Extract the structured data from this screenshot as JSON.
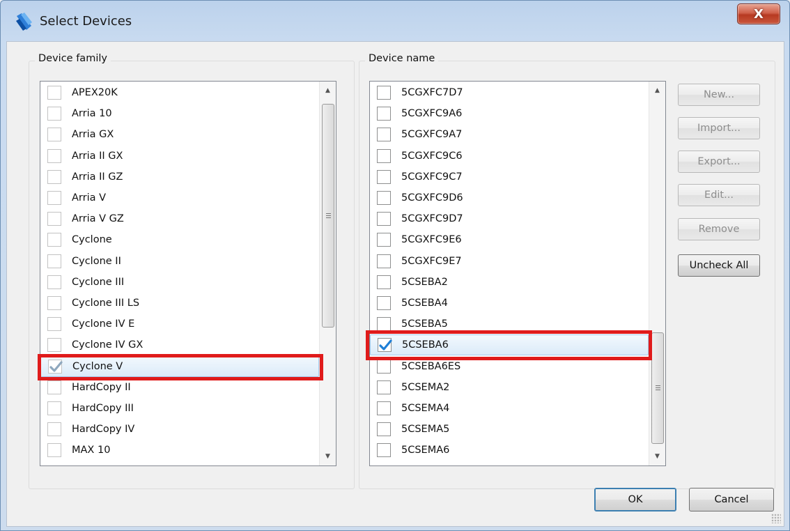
{
  "window": {
    "title": "Select Devices",
    "close_label": "X"
  },
  "device_family": {
    "label": "Device family",
    "items": [
      {
        "label": "APEX20K",
        "checked": false
      },
      {
        "label": "Arria 10",
        "checked": false
      },
      {
        "label": "Arria GX",
        "checked": false
      },
      {
        "label": "Arria II GX",
        "checked": false
      },
      {
        "label": "Arria II GZ",
        "checked": false
      },
      {
        "label": "Arria V",
        "checked": false
      },
      {
        "label": "Arria V GZ",
        "checked": false
      },
      {
        "label": "Cyclone",
        "checked": false
      },
      {
        "label": "Cyclone II",
        "checked": false
      },
      {
        "label": "Cyclone III",
        "checked": false
      },
      {
        "label": "Cyclone III LS",
        "checked": false
      },
      {
        "label": "Cyclone IV E",
        "checked": false
      },
      {
        "label": "Cyclone IV GX",
        "checked": false
      },
      {
        "label": "Cyclone V",
        "checked": true,
        "selected": true
      },
      {
        "label": "HardCopy II",
        "checked": false
      },
      {
        "label": "HardCopy III",
        "checked": false
      },
      {
        "label": "HardCopy IV",
        "checked": false
      },
      {
        "label": "MAX 10",
        "checked": false
      }
    ]
  },
  "device_name": {
    "label": "Device name",
    "items": [
      {
        "label": "5CGXFC7D7",
        "checked": false
      },
      {
        "label": "5CGXFC9A6",
        "checked": false
      },
      {
        "label": "5CGXFC9A7",
        "checked": false
      },
      {
        "label": "5CGXFC9C6",
        "checked": false
      },
      {
        "label": "5CGXFC9C7",
        "checked": false
      },
      {
        "label": "5CGXFC9D6",
        "checked": false
      },
      {
        "label": "5CGXFC9D7",
        "checked": false
      },
      {
        "label": "5CGXFC9E6",
        "checked": false
      },
      {
        "label": "5CGXFC9E7",
        "checked": false
      },
      {
        "label": "5CSEBA2",
        "checked": false
      },
      {
        "label": "5CSEBA4",
        "checked": false
      },
      {
        "label": "5CSEBA5",
        "checked": false
      },
      {
        "label": "5CSEBA6",
        "checked": true,
        "selected": true
      },
      {
        "label": "5CSEBA6ES",
        "checked": false
      },
      {
        "label": "5CSEMA2",
        "checked": false
      },
      {
        "label": "5CSEMA4",
        "checked": false
      },
      {
        "label": "5CSEMA5",
        "checked": false
      },
      {
        "label": "5CSEMA6",
        "checked": false
      }
    ]
  },
  "side_buttons": {
    "new": "New...",
    "import": "Import...",
    "export": "Export...",
    "edit": "Edit...",
    "remove": "Remove",
    "uncheck_all": "Uncheck All"
  },
  "footer": {
    "ok": "OK",
    "cancel": "Cancel"
  },
  "colors": {
    "highlight": "#e01b1b",
    "check_accent": "#1f7fd6",
    "check_dim": "#8fa8be"
  }
}
